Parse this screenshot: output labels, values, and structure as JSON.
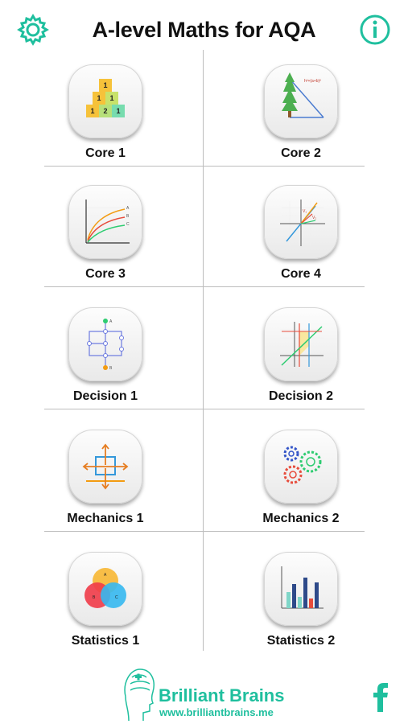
{
  "header": {
    "title": "A-level Maths for AQA"
  },
  "modules": [
    {
      "label": "Core 1"
    },
    {
      "label": "Core 2"
    },
    {
      "label": "Core 3"
    },
    {
      "label": "Core 4"
    },
    {
      "label": "Decision 1"
    },
    {
      "label": "Decision 2"
    },
    {
      "label": "Mechanics 1"
    },
    {
      "label": "Mechanics 2"
    },
    {
      "label": "Statistics 1"
    },
    {
      "label": "Statistics 2"
    }
  ],
  "icons": {
    "core1": {
      "blocks": [
        "1",
        "1",
        "1",
        "1",
        "2",
        "1"
      ]
    },
    "core2": {
      "formula": "h²+(a+b)²"
    },
    "core3": {
      "curves": [
        "A",
        "B",
        "C"
      ]
    },
    "core4": {
      "vectors": [
        "V₁",
        "V₂"
      ]
    },
    "decision1": {
      "nodes": [
        "A",
        "B"
      ]
    },
    "statistics1": {
      "circles": [
        "A",
        "B",
        "C"
      ]
    }
  },
  "footer": {
    "brand_name": "Brilliant Brains",
    "brand_url": "www.brilliantbrains.me"
  },
  "colors": {
    "accent": "#1fbf9e"
  }
}
